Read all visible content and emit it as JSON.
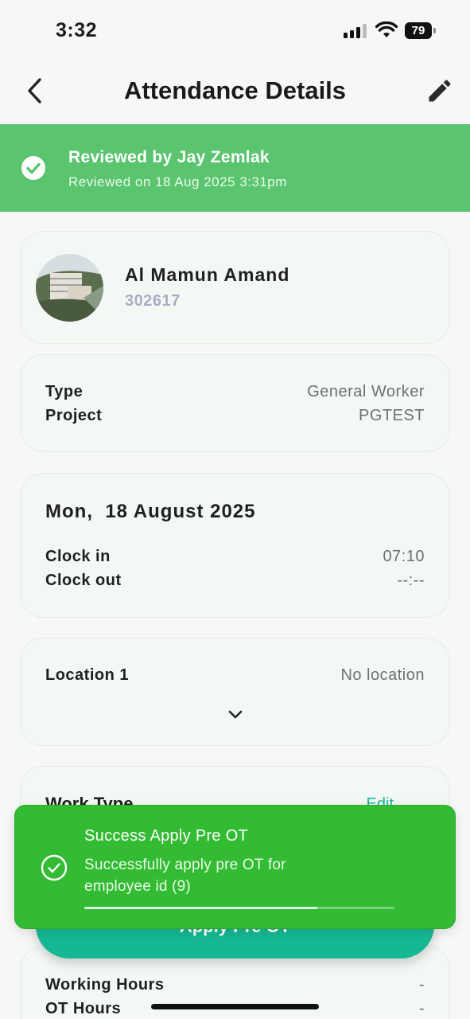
{
  "status_bar": {
    "time": "3:32",
    "battery": "79"
  },
  "header": {
    "title": "Attendance Details"
  },
  "review": {
    "title": "Reviewed by Jay Zemlak",
    "subtitle": "Reviewed on 18 Aug 2025 3:31pm"
  },
  "employee": {
    "name": "Al Mamun Amand",
    "id": "302617"
  },
  "info": {
    "type_label": "Type",
    "type_value": "General Worker",
    "project_label": "Project",
    "project_value": "PGTEST"
  },
  "attendance": {
    "date": "Mon,  18 August 2025",
    "clock_in_label": "Clock in",
    "clock_in_value": "07:10",
    "clock_out_label": "Clock out",
    "clock_out_value": "--:--"
  },
  "location": {
    "label": "Location 1",
    "value": "No location"
  },
  "work_type": {
    "label": "Work Type",
    "edit_label": "Edit"
  },
  "apply_button": {
    "label": "Apply Pre OT"
  },
  "hours": {
    "working_label": "Working Hours",
    "working_value": "-",
    "ot_label": "OT Hours",
    "ot_value": "-"
  },
  "toast": {
    "title": "Success Apply Pre OT",
    "message": "Successfully apply pre OT for employee id (9)",
    "progress": 0.75
  },
  "colors": {
    "banner": "#5ac46f",
    "toast": "#33bb33",
    "accent": "#16b894",
    "edit_link": "#19b59a"
  },
  "icons": [
    "back-chevron-icon",
    "pencil-icon",
    "check-circle-icon",
    "chevron-down-icon",
    "signal-icon",
    "wifi-icon",
    "battery-icon"
  ]
}
